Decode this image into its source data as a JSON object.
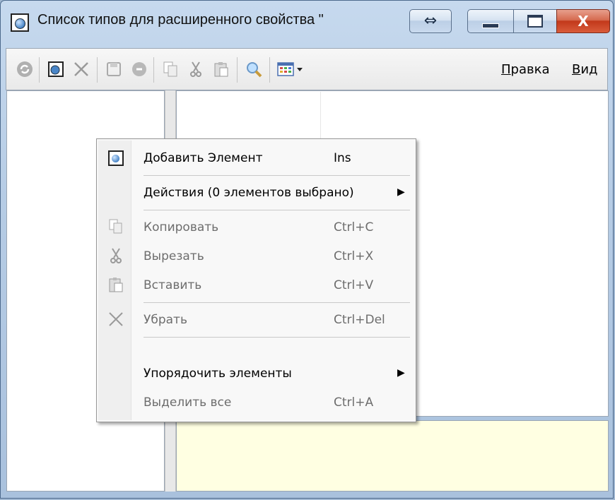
{
  "window": {
    "title": "Список типов для расширенного свойства \"",
    "resize_glyph": "⇔",
    "close_glyph": "X"
  },
  "toolbar": {
    "icons": [
      "refresh-icon",
      "add-item-icon",
      "delete-icon",
      "save-icon",
      "cancel-icon",
      "copy-icon",
      "cut-icon",
      "paste-icon",
      "search-icon",
      "view-options-icon"
    ],
    "menu_edit": "Правка",
    "menu_edit_accel": "П",
    "menu_edit_rest": "равка",
    "menu_view_accel": "В",
    "menu_view_rest": "ид"
  },
  "context_menu": {
    "items": [
      {
        "label": "Добавить Элемент",
        "shortcut": "Ins",
        "enabled": true,
        "icon": "add-item-icon"
      },
      {
        "label": "Действия (0 элементов выбрано)",
        "shortcut": "",
        "enabled": true,
        "submenu": true
      },
      {
        "label": "Копировать",
        "shortcut": "Ctrl+C",
        "enabled": false,
        "icon": "copy-icon"
      },
      {
        "label": "Вырезать",
        "shortcut": "Ctrl+X",
        "enabled": false,
        "icon": "cut-icon"
      },
      {
        "label": "Вставить",
        "shortcut": "Ctrl+V",
        "enabled": false,
        "icon": "paste-icon"
      },
      {
        "label": "Убрать",
        "shortcut": "Ctrl+Del",
        "enabled": false,
        "icon": "delete-icon"
      },
      {
        "label": "Упорядочить элементы",
        "shortcut": "",
        "enabled": true,
        "submenu": true
      },
      {
        "label": "Выделить все",
        "shortcut": "Ctrl+A",
        "enabled": false
      }
    ]
  },
  "colors": {
    "info_pane": "#ffffe2",
    "close_button": "#c2391b"
  }
}
